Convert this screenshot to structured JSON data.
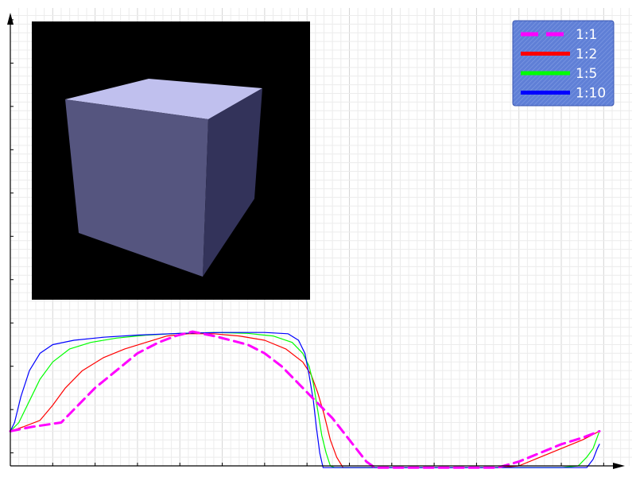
{
  "chart_data": {
    "type": "line",
    "title": "",
    "xlabel": "",
    "ylabel": "",
    "grid": true,
    "legend_placement": "top-right",
    "xlim": [
      0,
      14.5
    ],
    "ylim": [
      -0.3,
      10.2
    ],
    "x_tick_step": 1,
    "y_tick_step": 1,
    "series": [
      {
        "name": "1:1",
        "color": "#ff00ff",
        "dashed": true,
        "points": [
          [
            0.0,
            0.5
          ],
          [
            0.5,
            0.6
          ],
          [
            1.2,
            0.7
          ],
          [
            1.6,
            1.1
          ],
          [
            2.0,
            1.5
          ],
          [
            2.5,
            1.9
          ],
          [
            3.0,
            2.3
          ],
          [
            3.5,
            2.55
          ],
          [
            3.9,
            2.7
          ],
          [
            4.3,
            2.8
          ],
          [
            4.8,
            2.7
          ],
          [
            5.2,
            2.6
          ],
          [
            5.6,
            2.5
          ],
          [
            6.0,
            2.3
          ],
          [
            6.4,
            2.0
          ],
          [
            6.8,
            1.6
          ],
          [
            7.2,
            1.2
          ],
          [
            7.6,
            0.8
          ],
          [
            8.0,
            0.3
          ],
          [
            8.4,
            -0.2
          ],
          [
            8.6,
            -0.34
          ],
          [
            9.5,
            -0.34
          ],
          [
            10.5,
            -0.34
          ],
          [
            11.0,
            -0.34
          ],
          [
            11.5,
            -0.34
          ],
          [
            12.0,
            -0.2
          ],
          [
            12.5,
            0.0
          ],
          [
            13.0,
            0.2
          ],
          [
            13.5,
            0.35
          ],
          [
            13.9,
            0.5
          ]
        ]
      },
      {
        "name": "1:2",
        "color": "#ff0000",
        "dashed": false,
        "points": [
          [
            0.0,
            0.5
          ],
          [
            0.3,
            0.6
          ],
          [
            0.7,
            0.75
          ],
          [
            1.0,
            1.1
          ],
          [
            1.3,
            1.5
          ],
          [
            1.7,
            1.9
          ],
          [
            2.2,
            2.2
          ],
          [
            2.7,
            2.4
          ],
          [
            3.2,
            2.55
          ],
          [
            3.7,
            2.7
          ],
          [
            4.2,
            2.75
          ],
          [
            4.8,
            2.75
          ],
          [
            5.4,
            2.7
          ],
          [
            6.0,
            2.6
          ],
          [
            6.5,
            2.4
          ],
          [
            6.9,
            2.1
          ],
          [
            7.1,
            1.8
          ],
          [
            7.25,
            1.4
          ],
          [
            7.4,
            0.9
          ],
          [
            7.55,
            0.3
          ],
          [
            7.7,
            -0.1
          ],
          [
            7.85,
            -0.34
          ],
          [
            9.0,
            -0.34
          ],
          [
            10.0,
            -0.34
          ],
          [
            11.0,
            -0.34
          ],
          [
            11.5,
            -0.34
          ],
          [
            12.0,
            -0.3
          ],
          [
            12.5,
            -0.1
          ],
          [
            13.0,
            0.1
          ],
          [
            13.5,
            0.3
          ],
          [
            13.9,
            0.5
          ]
        ]
      },
      {
        "name": "1:5",
        "color": "#00ff00",
        "dashed": false,
        "points": [
          [
            0.0,
            0.5
          ],
          [
            0.2,
            0.7
          ],
          [
            0.45,
            1.2
          ],
          [
            0.7,
            1.7
          ],
          [
            1.0,
            2.1
          ],
          [
            1.4,
            2.4
          ],
          [
            1.9,
            2.55
          ],
          [
            2.5,
            2.65
          ],
          [
            3.2,
            2.72
          ],
          [
            4.0,
            2.76
          ],
          [
            4.8,
            2.78
          ],
          [
            5.6,
            2.76
          ],
          [
            6.2,
            2.7
          ],
          [
            6.65,
            2.55
          ],
          [
            6.9,
            2.3
          ],
          [
            7.05,
            2.0
          ],
          [
            7.15,
            1.6
          ],
          [
            7.25,
            1.0
          ],
          [
            7.35,
            0.4
          ],
          [
            7.45,
            0.0
          ],
          [
            7.55,
            -0.3
          ],
          [
            7.65,
            -0.34
          ],
          [
            9.0,
            -0.34
          ],
          [
            10.0,
            -0.34
          ],
          [
            11.0,
            -0.34
          ],
          [
            12.0,
            -0.34
          ],
          [
            13.0,
            -0.34
          ],
          [
            13.4,
            -0.3
          ],
          [
            13.6,
            -0.1
          ],
          [
            13.75,
            0.1
          ],
          [
            13.9,
            0.5
          ]
        ]
      },
      {
        "name": "1:10",
        "color": "#0000ff",
        "dashed": false,
        "points": [
          [
            0.0,
            0.5
          ],
          [
            0.1,
            0.7
          ],
          [
            0.25,
            1.3
          ],
          [
            0.45,
            1.9
          ],
          [
            0.7,
            2.3
          ],
          [
            1.0,
            2.5
          ],
          [
            1.5,
            2.6
          ],
          [
            2.2,
            2.67
          ],
          [
            3.0,
            2.72
          ],
          [
            4.0,
            2.76
          ],
          [
            5.0,
            2.78
          ],
          [
            6.0,
            2.78
          ],
          [
            6.55,
            2.75
          ],
          [
            6.8,
            2.6
          ],
          [
            6.95,
            2.3
          ],
          [
            7.05,
            1.8
          ],
          [
            7.15,
            1.2
          ],
          [
            7.22,
            0.6
          ],
          [
            7.3,
            0.0
          ],
          [
            7.38,
            -0.34
          ],
          [
            9.0,
            -0.34
          ],
          [
            10.0,
            -0.34
          ],
          [
            11.0,
            -0.34
          ],
          [
            12.0,
            -0.34
          ],
          [
            13.0,
            -0.34
          ],
          [
            13.6,
            -0.34
          ],
          [
            13.75,
            -0.15
          ],
          [
            13.85,
            0.1
          ],
          [
            13.9,
            0.2
          ]
        ]
      }
    ]
  },
  "legend": {
    "entries": [
      "1:1",
      "1:2",
      "1:5",
      "1:10"
    ]
  },
  "inset": {
    "background": "#000000",
    "cube_top_color": "#c0c0ee",
    "cube_front_color": "#55557f",
    "cube_side_color": "#33335a"
  }
}
